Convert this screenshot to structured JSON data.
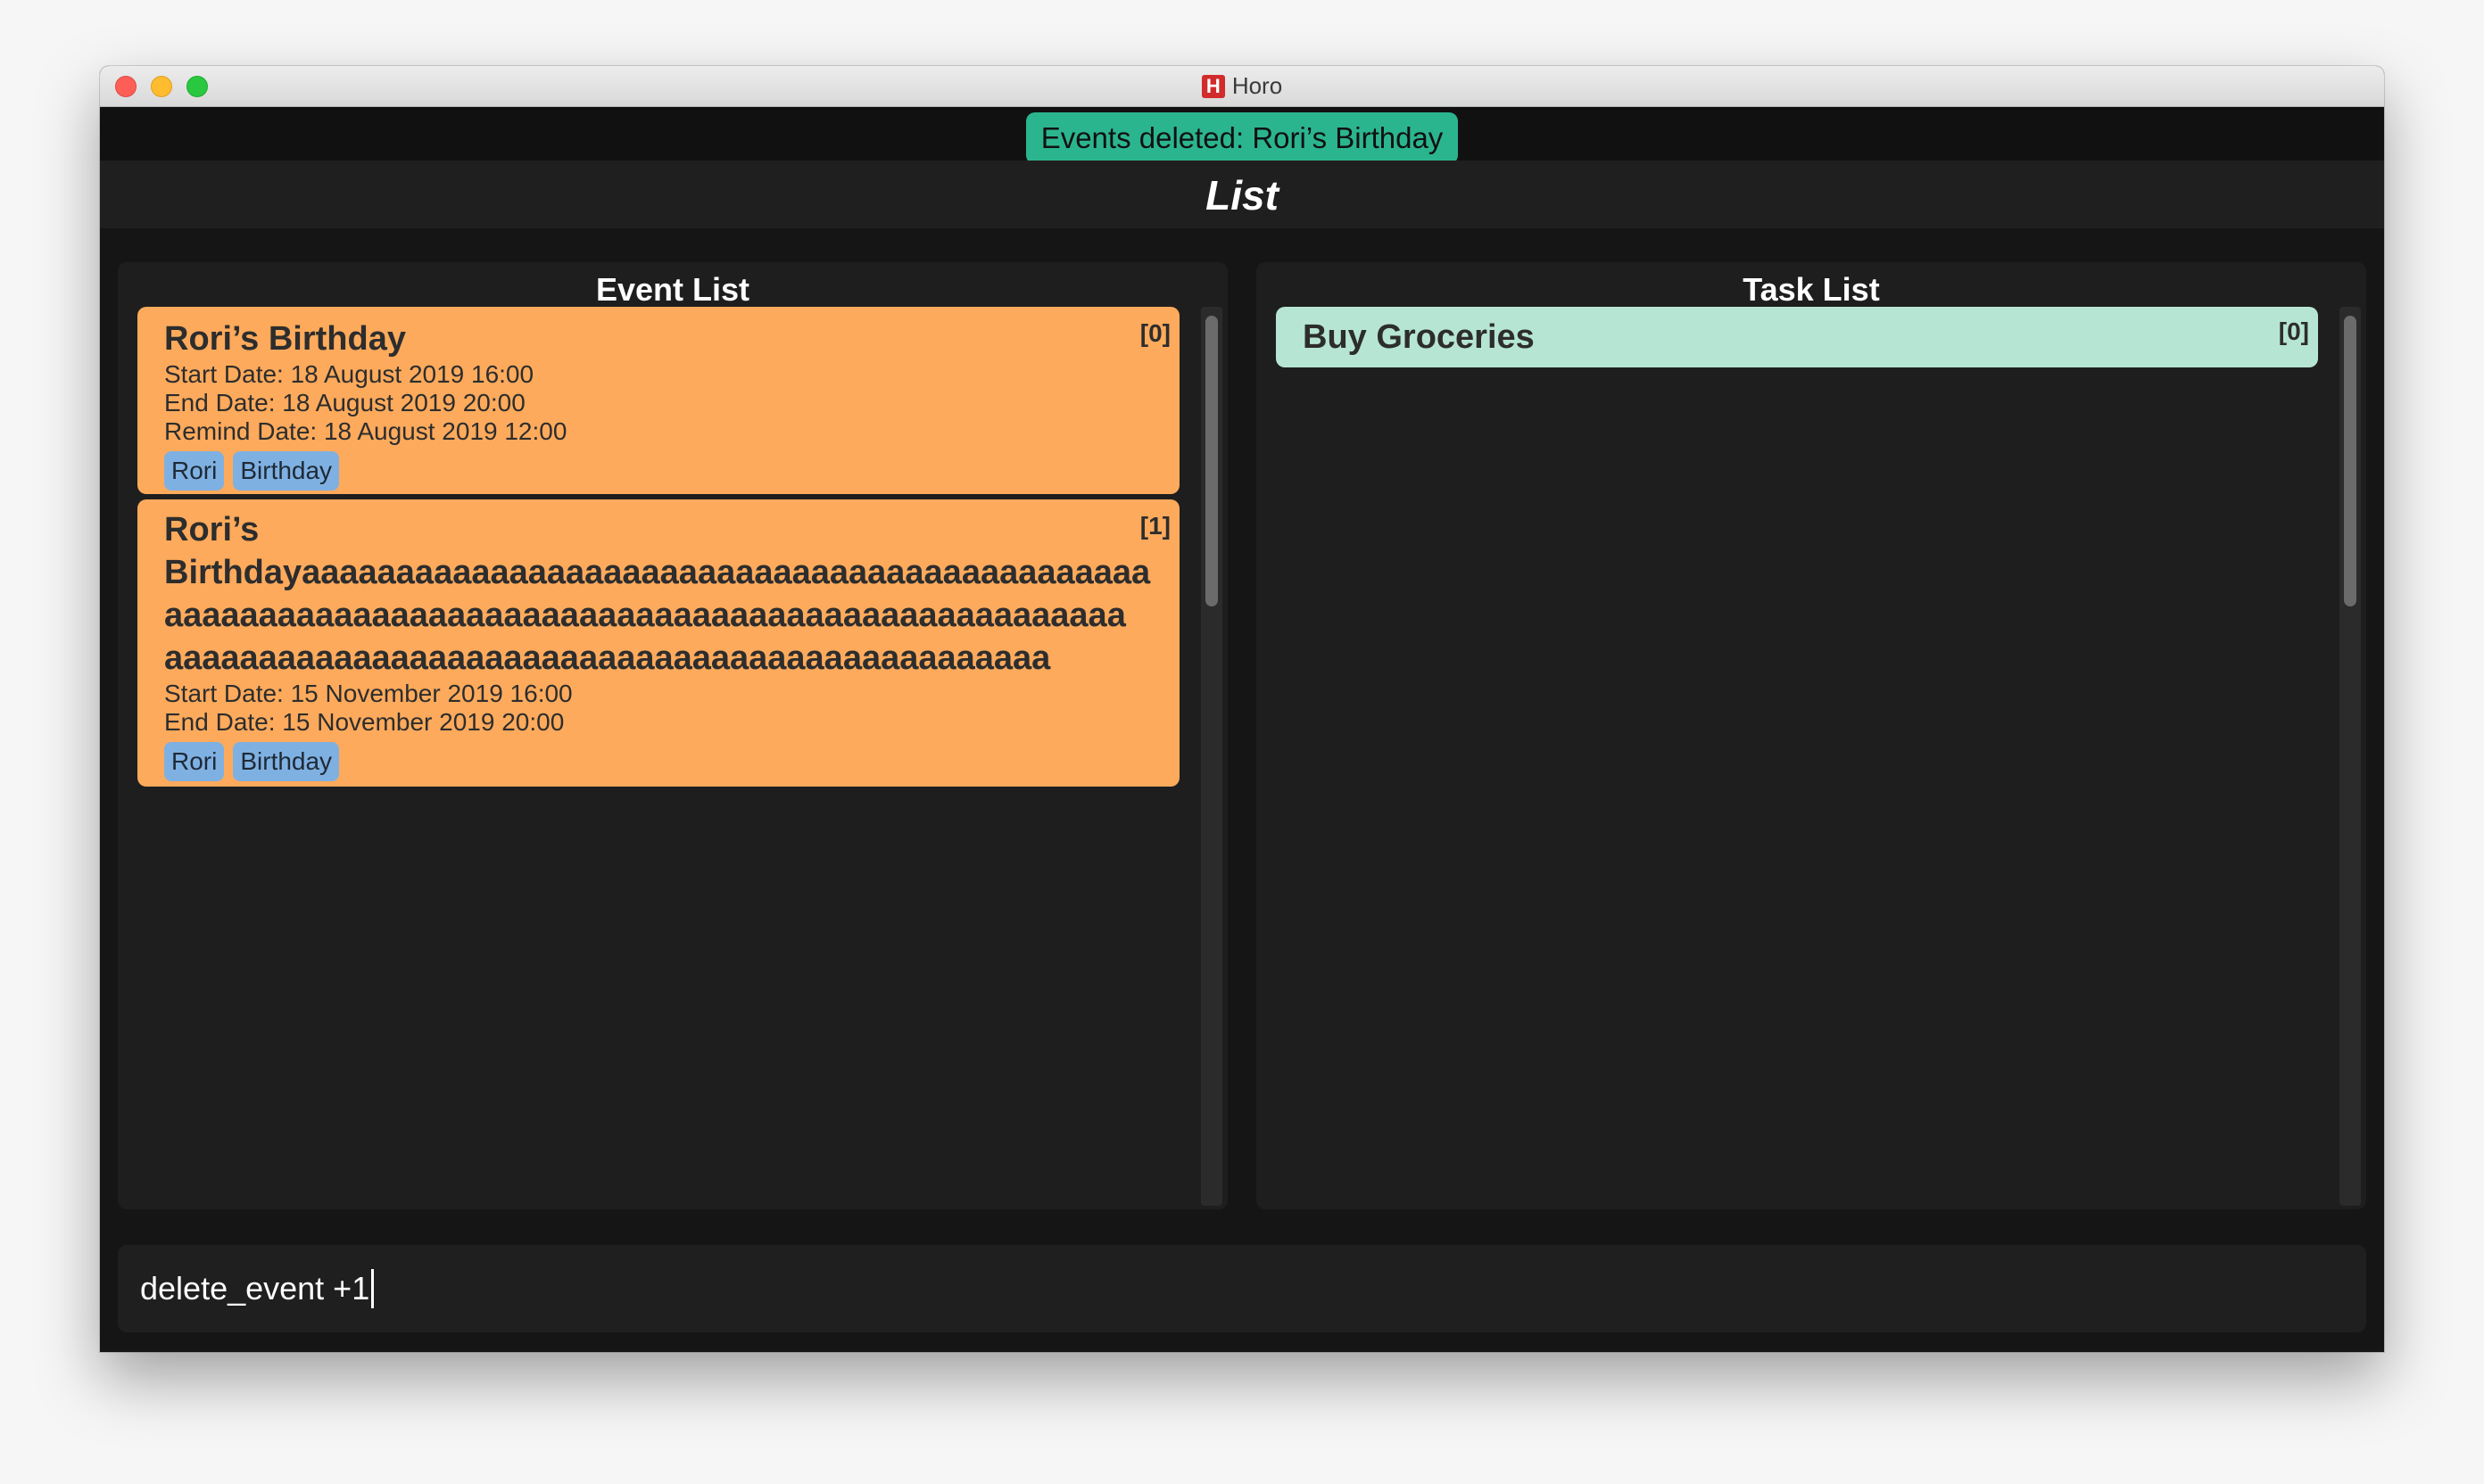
{
  "window": {
    "title": "Horo",
    "app_icon_letter": "H"
  },
  "result_display": {
    "text": "Events deleted: Rori’s Birthday"
  },
  "view": {
    "title": "List"
  },
  "event_list": {
    "title": "Event List",
    "events": [
      {
        "index": "[0]",
        "name": "Rori’s Birthday",
        "start": "Start Date: 18 August 2019 16:00",
        "end": "End Date: 18 August 2019 20:00",
        "remind": "Remind Date: 18 August 2019 12:00",
        "tags": [
          "Rori",
          "Birthday"
        ]
      },
      {
        "index": "[1]",
        "name_line1": "Rori’s",
        "name_line2": "Birthdayaaaaaaaaaaaaaaaaaaaaaaaaaaaaaaaaaaaaaaaaaaaaa",
        "name_line3": "aaaaaaaaaaaaaaaaaaaaaaaaaaaaaaaaaaaaaaaaaaaaaaaaaaa",
        "name_line4": "aaaaaaaaaaaaaaaaaaaaaaaaaaaaaaaaaaaaaaaaaaaaaaa",
        "start": "Start Date: 15 November 2019 16:00",
        "end": "End Date: 15 November 2019 20:00",
        "tags": [
          "Rori",
          "Birthday"
        ]
      }
    ]
  },
  "task_list": {
    "title": "Task List",
    "tasks": [
      {
        "index": "[0]",
        "name": "Buy Groceries"
      }
    ]
  },
  "command_box": {
    "value": "delete_event +1"
  },
  "colors": {
    "event_card": "#fdaa5c",
    "task_card": "#b6e6d3",
    "tag": "#7fb0e2",
    "result_pill": "#2bb58f",
    "background": "#151515"
  }
}
